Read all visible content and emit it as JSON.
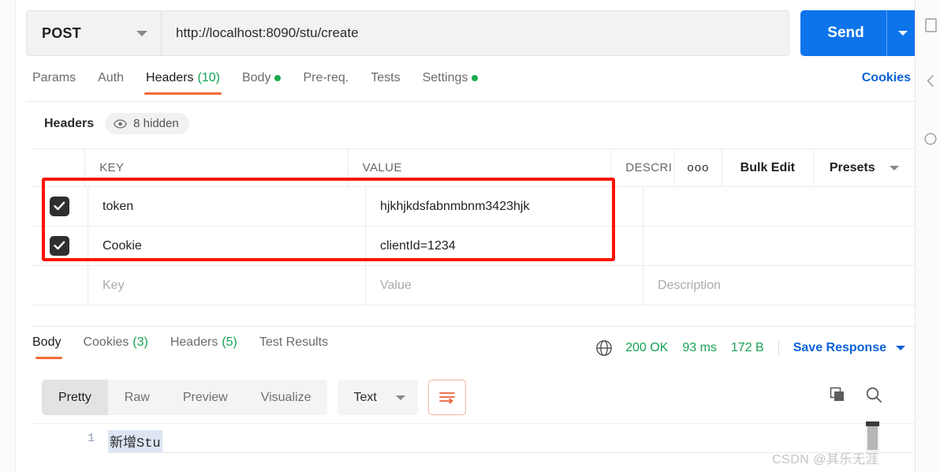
{
  "request": {
    "method": "POST",
    "url": "http://localhost:8090/stu/create",
    "send_label": "Send",
    "tabs": [
      {
        "label": "Params",
        "count": "",
        "dot": false,
        "active": false
      },
      {
        "label": "Auth",
        "count": "",
        "dot": false,
        "active": false
      },
      {
        "label": "Headers",
        "count": "(10)",
        "dot": false,
        "active": true
      },
      {
        "label": "Body",
        "count": "",
        "dot": true,
        "active": false
      },
      {
        "label": "Pre-req.",
        "count": "",
        "dot": false,
        "active": false
      },
      {
        "label": "Tests",
        "count": "",
        "dot": false,
        "active": false
      },
      {
        "label": "Settings",
        "count": "",
        "dot": true,
        "active": false
      }
    ],
    "cookies_link": "Cookies"
  },
  "headers_section": {
    "title": "Headers",
    "hidden_pill": "8 hidden",
    "columns": {
      "key": "KEY",
      "value": "VALUE",
      "description": "DESCRI"
    },
    "toolbar": {
      "dots": "ooo",
      "bulk_edit": "Bulk Edit",
      "presets": "Presets"
    },
    "rows": [
      {
        "checked": true,
        "key": "token",
        "value": "hjkhjkdsfabnmbnm3423hjk",
        "description": ""
      },
      {
        "checked": true,
        "key": "Cookie",
        "value": "clientId=1234",
        "description": ""
      }
    ],
    "placeholder_row": {
      "key": "Key",
      "value": "Value",
      "description": "Description"
    }
  },
  "response": {
    "tabs": [
      {
        "label": "Body",
        "count": "",
        "active": true
      },
      {
        "label": "Cookies",
        "count": "(3)",
        "active": false
      },
      {
        "label": "Headers",
        "count": "(5)",
        "active": false
      },
      {
        "label": "Test Results",
        "count": "",
        "active": false
      }
    ],
    "status": "200 OK",
    "time": "93 ms",
    "size": "172 B",
    "save_response": "Save Response",
    "view_modes": [
      {
        "label": "Pretty",
        "active": true
      },
      {
        "label": "Raw",
        "active": false
      },
      {
        "label": "Preview",
        "active": false
      },
      {
        "label": "Visualize",
        "active": false
      }
    ],
    "format": "Text",
    "body": {
      "line_number": "1",
      "line_text": "新增Stu"
    }
  },
  "watermark": "CSDN @其乐无涯",
  "colors": {
    "accent_orange": "#f26b3a",
    "send_blue": "#0d74ec",
    "link_blue": "#0d63d8",
    "success_green": "#18a253",
    "annotation_red": "#fb1405"
  }
}
